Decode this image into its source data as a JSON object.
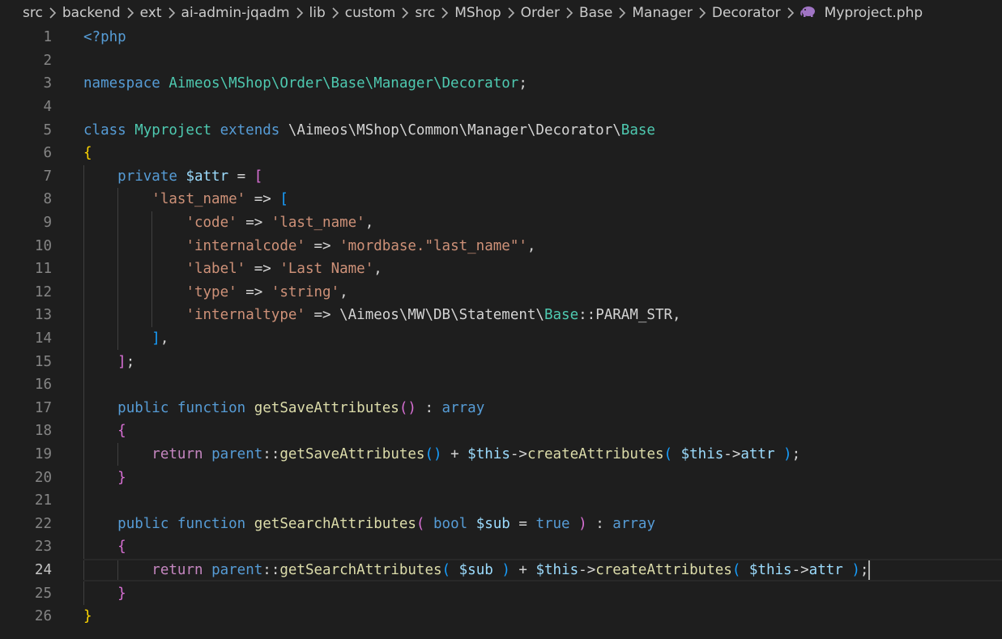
{
  "breadcrumb": {
    "segments": [
      "src",
      "backend",
      "ext",
      "ai-admin-jqadm",
      "lib",
      "custom",
      "src",
      "MShop",
      "Order",
      "Base",
      "Manager",
      "Decorator"
    ],
    "file": "Myproject.php",
    "file_icon": "php-elephant-icon"
  },
  "editor": {
    "current_line": 24,
    "theme_colors": {
      "keyword": "#569cd6",
      "control": "#c586c0",
      "class": "#4ec9b0",
      "function": "#dcdcaa",
      "variable": "#9cdcfe",
      "string": "#ce9178",
      "text": "#d4d4d4",
      "bracket_level_1": "#ffd700",
      "bracket_level_2": "#da70d6",
      "bracket_level_3": "#179fff"
    },
    "lines": [
      {
        "n": "1",
        "tokens": [
          [
            "kw",
            "<?php"
          ]
        ]
      },
      {
        "n": "2",
        "tokens": []
      },
      {
        "n": "3",
        "tokens": [
          [
            "kw",
            "namespace "
          ],
          [
            "cls",
            "Aimeos\\MShop\\Order\\Base\\Manager\\Decorator"
          ],
          [
            "txt",
            ";"
          ]
        ]
      },
      {
        "n": "4",
        "tokens": []
      },
      {
        "n": "5",
        "tokens": [
          [
            "kw",
            "class "
          ],
          [
            "cls",
            "Myproject "
          ],
          [
            "kw",
            "extends "
          ],
          [
            "txt",
            "\\Aimeos\\MShop\\Common\\Manager\\Decorator\\"
          ],
          [
            "cls",
            "Base"
          ]
        ]
      },
      {
        "n": "6",
        "tokens": [
          [
            "b1",
            "{"
          ]
        ]
      },
      {
        "n": "7",
        "tokens": [
          [
            "txt",
            "    "
          ],
          [
            "kw",
            "private "
          ],
          [
            "var",
            "$attr "
          ],
          [
            "txt",
            "= "
          ],
          [
            "b2",
            "["
          ]
        ]
      },
      {
        "n": "8",
        "tokens": [
          [
            "txt",
            "        "
          ],
          [
            "str",
            "'last_name'"
          ],
          [
            "txt",
            " => "
          ],
          [
            "b3",
            "["
          ]
        ]
      },
      {
        "n": "9",
        "tokens": [
          [
            "txt",
            "            "
          ],
          [
            "str",
            "'code'"
          ],
          [
            "txt",
            " => "
          ],
          [
            "str",
            "'last_name'"
          ],
          [
            "txt",
            ","
          ]
        ]
      },
      {
        "n": "10",
        "tokens": [
          [
            "txt",
            "            "
          ],
          [
            "str",
            "'internalcode'"
          ],
          [
            "txt",
            " => "
          ],
          [
            "str",
            "'mordbase.\"last_name\"'"
          ],
          [
            "txt",
            ","
          ]
        ]
      },
      {
        "n": "11",
        "tokens": [
          [
            "txt",
            "            "
          ],
          [
            "str",
            "'label'"
          ],
          [
            "txt",
            " => "
          ],
          [
            "str",
            "'Last Name'"
          ],
          [
            "txt",
            ","
          ]
        ]
      },
      {
        "n": "12",
        "tokens": [
          [
            "txt",
            "            "
          ],
          [
            "str",
            "'type'"
          ],
          [
            "txt",
            " => "
          ],
          [
            "str",
            "'string'"
          ],
          [
            "txt",
            ","
          ]
        ]
      },
      {
        "n": "13",
        "tokens": [
          [
            "txt",
            "            "
          ],
          [
            "str",
            "'internaltype'"
          ],
          [
            "txt",
            " => \\Aimeos\\MW\\DB\\Statement\\"
          ],
          [
            "cls",
            "Base"
          ],
          [
            "txt",
            "::PARAM_STR,"
          ]
        ]
      },
      {
        "n": "14",
        "tokens": [
          [
            "txt",
            "        "
          ],
          [
            "b3",
            "]"
          ],
          [
            "txt",
            ","
          ]
        ]
      },
      {
        "n": "15",
        "tokens": [
          [
            "txt",
            "    "
          ],
          [
            "b2",
            "]"
          ],
          [
            "txt",
            ";"
          ]
        ]
      },
      {
        "n": "16",
        "tokens": []
      },
      {
        "n": "17",
        "tokens": [
          [
            "txt",
            "    "
          ],
          [
            "kw",
            "public function "
          ],
          [
            "fn",
            "getSaveAttributes"
          ],
          [
            "b2",
            "()"
          ],
          [
            "txt",
            " : "
          ],
          [
            "kw",
            "array"
          ]
        ]
      },
      {
        "n": "18",
        "tokens": [
          [
            "txt",
            "    "
          ],
          [
            "b2",
            "{"
          ]
        ]
      },
      {
        "n": "19",
        "tokens": [
          [
            "txt",
            "        "
          ],
          [
            "ctl",
            "return "
          ],
          [
            "kw",
            "parent"
          ],
          [
            "txt",
            "::"
          ],
          [
            "fn",
            "getSaveAttributes"
          ],
          [
            "b3",
            "()"
          ],
          [
            "txt",
            " + "
          ],
          [
            "var",
            "$this"
          ],
          [
            "txt",
            "->"
          ],
          [
            "fn",
            "createAttributes"
          ],
          [
            "b3",
            "( "
          ],
          [
            "var",
            "$this"
          ],
          [
            "txt",
            "->"
          ],
          [
            "var",
            "attr "
          ],
          [
            "b3",
            ")"
          ],
          [
            "txt",
            ";"
          ]
        ]
      },
      {
        "n": "20",
        "tokens": [
          [
            "txt",
            "    "
          ],
          [
            "b2",
            "}"
          ]
        ]
      },
      {
        "n": "21",
        "tokens": []
      },
      {
        "n": "22",
        "tokens": [
          [
            "txt",
            "    "
          ],
          [
            "kw",
            "public function "
          ],
          [
            "fn",
            "getSearchAttributes"
          ],
          [
            "b2",
            "( "
          ],
          [
            "kw",
            "bool "
          ],
          [
            "var",
            "$sub "
          ],
          [
            "txt",
            "= "
          ],
          [
            "kw",
            "true "
          ],
          [
            "b2",
            ")"
          ],
          [
            "txt",
            " : "
          ],
          [
            "kw",
            "array"
          ]
        ]
      },
      {
        "n": "23",
        "tokens": [
          [
            "txt",
            "    "
          ],
          [
            "b2",
            "{"
          ]
        ]
      },
      {
        "n": "24",
        "tokens": [
          [
            "txt",
            "        "
          ],
          [
            "ctl",
            "return "
          ],
          [
            "kw",
            "parent"
          ],
          [
            "txt",
            "::"
          ],
          [
            "fn",
            "getSearchAttributes"
          ],
          [
            "b3",
            "( "
          ],
          [
            "var",
            "$sub "
          ],
          [
            "b3",
            ")"
          ],
          [
            "txt",
            " + "
          ],
          [
            "var",
            "$this"
          ],
          [
            "txt",
            "->"
          ],
          [
            "fn",
            "createAttributes"
          ],
          [
            "b3",
            "( "
          ],
          [
            "var",
            "$this"
          ],
          [
            "txt",
            "->"
          ],
          [
            "var",
            "attr "
          ],
          [
            "b3",
            ")"
          ],
          [
            "txt",
            ";"
          ]
        ]
      },
      {
        "n": "25",
        "tokens": [
          [
            "txt",
            "    "
          ],
          [
            "b2",
            "}"
          ]
        ]
      },
      {
        "n": "26",
        "tokens": [
          [
            "b1",
            "}"
          ]
        ]
      }
    ]
  }
}
